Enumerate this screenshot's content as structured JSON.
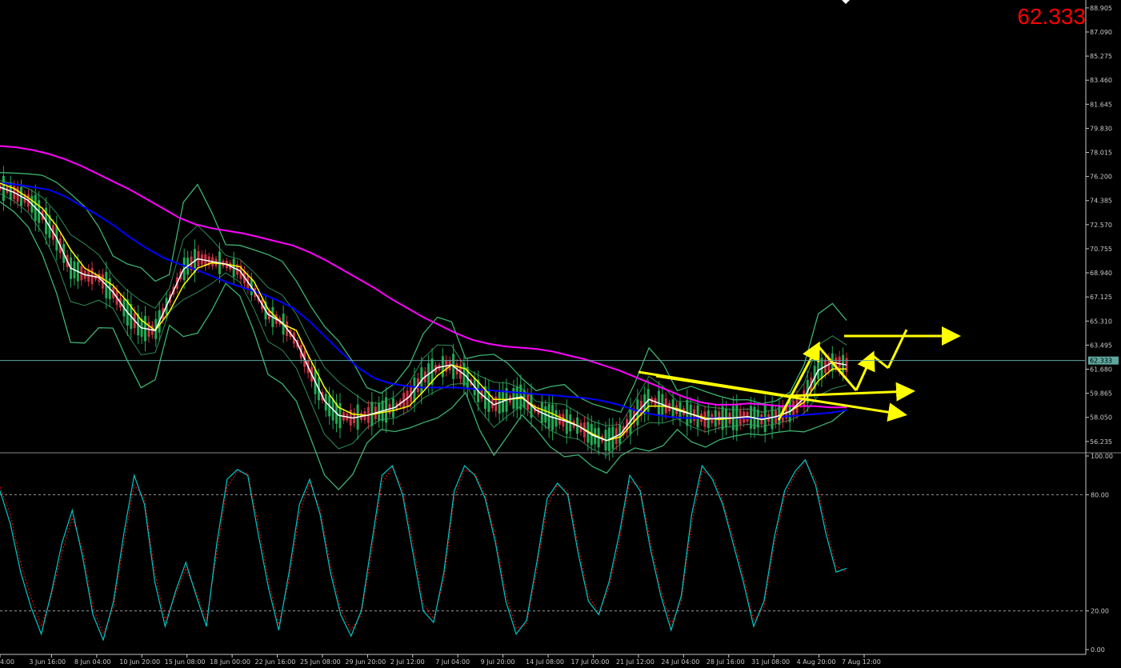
{
  "price_label": "62.333",
  "current_price": 62.333,
  "chart_data": [
    {
      "type": "line",
      "panel": "main",
      "ylim": [
        55.5,
        89.2
      ],
      "y_ticks": [
        "88.905",
        "87.090",
        "85.275",
        "83.460",
        "81.645",
        "79.830",
        "78.015",
        "76.200",
        "74.385",
        "72.570",
        "70.755",
        "68.940",
        "67.125",
        "65.310",
        "63.495",
        "61.680",
        "59.865",
        "58.050",
        "56.235"
      ],
      "x_ticks": [
        "4:00",
        "3 Jun 16:00",
        "8 Jun 04:00",
        "10 Jun 20:00",
        "15 Jun 08:00",
        "18 Jun 00:00",
        "22 Jun 16:00",
        "25 Jun 08:00",
        "29 Jun 20:00",
        "2 Jul 12:00",
        "7 Jul 04:00",
        "9 Jul 20:00",
        "14 Jul 08:00",
        "17 Jul 00:00",
        "21 Jul 12:00",
        "24 Jul 04:00",
        "28 Jul 16:00",
        "31 Jul 08:00",
        "4 Aug 20:00",
        "7 Aug 12:00"
      ],
      "current_price_line": 62.333,
      "series": [
        {
          "color": "#ff00ff",
          "values": [
            78.5,
            78.4,
            78.2,
            77.9,
            77.5,
            77.0,
            76.4,
            75.8,
            75.2,
            74.5,
            73.8,
            73.1,
            72.6,
            72.3,
            72.1,
            71.9,
            71.6,
            71.3,
            71.0,
            70.5,
            69.9,
            69.2,
            68.5,
            67.8,
            67.0,
            66.3,
            65.6,
            65.0,
            64.4,
            63.9,
            63.6,
            63.4,
            63.3,
            63.2,
            63.0,
            62.7,
            62.4,
            62.0,
            61.6,
            61.1,
            60.6,
            60.1,
            59.6,
            59.2,
            59.0,
            59.0,
            59.1,
            59.0,
            58.9,
            58.9,
            58.9,
            58.8,
            58.8
          ]
        },
        {
          "color": "#0000ff",
          "values": [
            75.7,
            75.6,
            75.4,
            75.2,
            74.7,
            74.0,
            73.3,
            72.5,
            71.6,
            70.8,
            70.1,
            69.6,
            69.2,
            68.7,
            68.2,
            67.8,
            67.4,
            66.9,
            66.3,
            65.3,
            64.1,
            62.9,
            61.8,
            61.0,
            60.6,
            60.4,
            60.3,
            60.3,
            60.3,
            60.2,
            60.1,
            60.0,
            59.9,
            59.8,
            59.7,
            59.6,
            59.5,
            59.3,
            59.0,
            58.6,
            58.3,
            58.1,
            58.0,
            58.0,
            58.0,
            58.0,
            58.0,
            58.0,
            58.1,
            58.2,
            58.3,
            58.4,
            58.6
          ]
        },
        {
          "color": "#ffff00",
          "values": [
            75.7,
            75.3,
            74.6,
            73.8,
            72.5,
            70.7,
            69.3,
            68.7,
            68.0,
            66.8,
            65.4,
            64.6,
            66.0,
            68.0,
            69.3,
            69.7,
            69.6,
            69.4,
            68.3,
            66.2,
            65.1,
            64.6,
            62.4,
            60.3,
            58.8,
            58.3,
            58.2,
            58.4,
            58.6,
            58.9,
            60.0,
            61.2,
            62.0,
            61.7,
            60.6,
            59.4,
            59.4,
            59.5,
            58.8,
            58.4,
            57.9,
            57.4,
            56.8,
            56.3,
            56.6,
            57.8,
            58.9,
            58.9,
            58.7,
            58.3,
            58.0,
            57.9,
            58.0,
            58.1,
            57.9,
            58.1,
            58.5,
            59.2,
            60.8,
            61.7,
            61.7
          ]
        },
        {
          "color": "#ffffff",
          "values": [
            75.4,
            75.0,
            74.4,
            73.3,
            71.6,
            69.3,
            68.8,
            68.6,
            67.5,
            66.0,
            64.8,
            64.6,
            66.9,
            69.2,
            70.0,
            69.8,
            69.6,
            69.1,
            67.6,
            65.8,
            65.2,
            63.8,
            61.5,
            59.3,
            58.2,
            58.0,
            58.2,
            58.5,
            58.8,
            59.6,
            61.0,
            61.8,
            62.0,
            61.2,
            59.9,
            59.0,
            59.4,
            59.6,
            58.6,
            58.1,
            57.8,
            57.4,
            56.7,
            56.3,
            56.8,
            58.2,
            59.4,
            59.0,
            58.6,
            58.3,
            57.9,
            58.0,
            58.0,
            58.1,
            57.9,
            58.1,
            58.5,
            59.5,
            61.6,
            62.2,
            62.0
          ]
        }
      ]
    },
    {
      "type": "line",
      "panel": "stochastic",
      "ylim": [
        0,
        100
      ],
      "y_ticks": [
        "100.00",
        "80.00",
        "20.00",
        "0.00"
      ],
      "levels": [
        80,
        20
      ],
      "series": [
        {
          "color": "#00c8c8",
          "values": [
            82,
            65,
            40,
            22,
            8,
            30,
            55,
            72,
            48,
            18,
            5,
            25,
            60,
            90,
            75,
            35,
            12,
            30,
            45,
            28,
            12,
            55,
            88,
            93,
            90,
            60,
            32,
            10,
            40,
            75,
            88,
            70,
            40,
            18,
            7,
            20,
            55,
            90,
            95,
            80,
            50,
            20,
            14,
            40,
            82,
            95,
            90,
            78,
            55,
            25,
            8,
            15,
            45,
            78,
            86,
            80,
            50,
            25,
            18,
            35,
            60,
            90,
            82,
            52,
            28,
            10,
            28,
            70,
            95,
            88,
            75,
            55,
            35,
            12,
            25,
            58,
            82,
            92,
            98,
            85,
            60,
            40,
            42
          ]
        },
        {
          "color": "#ff0000",
          "values": [
            84,
            70,
            45,
            27,
            12,
            28,
            50,
            68,
            52,
            22,
            8,
            22,
            55,
            85,
            78,
            40,
            15,
            28,
            42,
            30,
            15,
            50,
            84,
            92,
            91,
            65,
            36,
            13,
            36,
            70,
            86,
            73,
            44,
            21,
            10,
            18,
            50,
            86,
            94,
            83,
            55,
            24,
            16,
            36,
            78,
            93,
            91,
            80,
            58,
            29,
            11,
            13,
            41,
            74,
            85,
            82,
            54,
            28,
            19,
            32,
            56,
            87,
            84,
            56,
            31,
            13,
            25,
            65,
            92,
            90,
            77,
            58,
            38,
            15,
            22,
            54,
            79,
            90,
            97,
            88,
            64,
            43,
            40
          ]
        }
      ]
    }
  ]
}
